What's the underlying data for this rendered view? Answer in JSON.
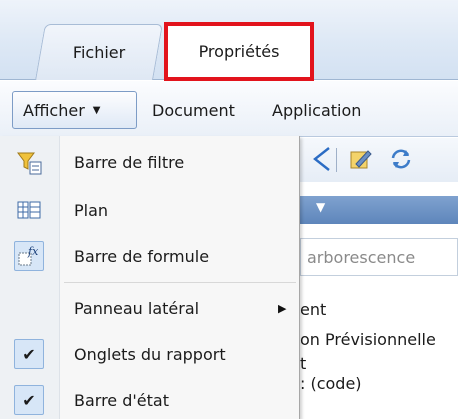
{
  "tabs": [
    {
      "label": "Fichier",
      "active": false
    },
    {
      "label": "Propriétés",
      "active": true,
      "highlighted": true
    }
  ],
  "menubar": {
    "afficher": "Afficher",
    "document": "Document",
    "application": "Application"
  },
  "dropdown": {
    "items": [
      {
        "label": "Barre de filtre",
        "icon": "filter-bar-icon",
        "checked": false
      },
      {
        "label": "Plan",
        "icon": "outline-icon",
        "checked": false
      },
      {
        "label": "Barre de formule",
        "icon": "formula-icon",
        "checked": false,
        "selected": true
      },
      {
        "label": "Panneau latéral",
        "icon": "",
        "checked": false,
        "submenu": true
      },
      {
        "label": "Onglets du rapport",
        "icon": "checkmark-icon",
        "checked": true
      },
      {
        "label": "Barre d'état",
        "icon": "checkmark-icon",
        "checked": true
      }
    ]
  },
  "background": {
    "search_placeholder": "arborescence",
    "lines": [
      "ent",
      "on Prévisionnelle",
      "t",
      ": (code)"
    ]
  },
  "colors": {
    "highlight_border": "#e2131c",
    "accent_blue": "#5e86bb",
    "check_bg": "#d7e6f7"
  }
}
